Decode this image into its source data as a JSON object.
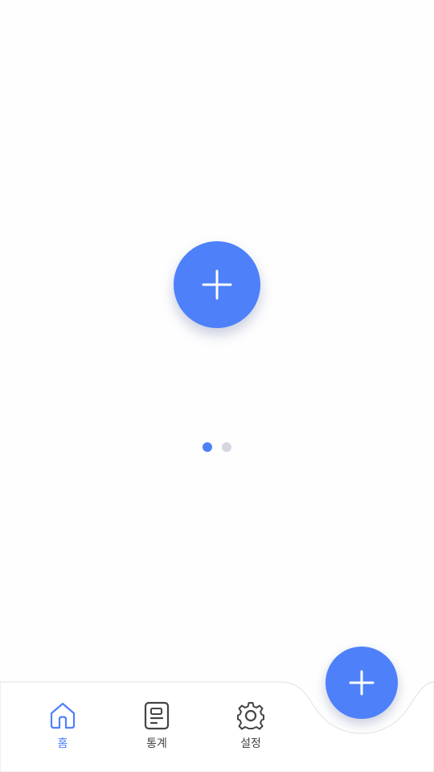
{
  "colors": {
    "accent": "#4e80fa",
    "dot_inactive": "#d4d8de",
    "nav_inactive": "#444444",
    "background": "#fefefe",
    "bar_border": "#e6e6e6"
  },
  "main": {
    "add_button": {
      "icon": "plus-icon"
    }
  },
  "pager": {
    "total": 2,
    "active_index": 0
  },
  "bottom_nav": {
    "items": [
      {
        "label": "홈",
        "icon": "home-icon",
        "active": true
      },
      {
        "label": "통계",
        "icon": "statistics-document-icon",
        "active": false
      },
      {
        "label": "설정",
        "icon": "gear-icon",
        "active": false
      }
    ],
    "fab": {
      "icon": "plus-icon"
    }
  }
}
